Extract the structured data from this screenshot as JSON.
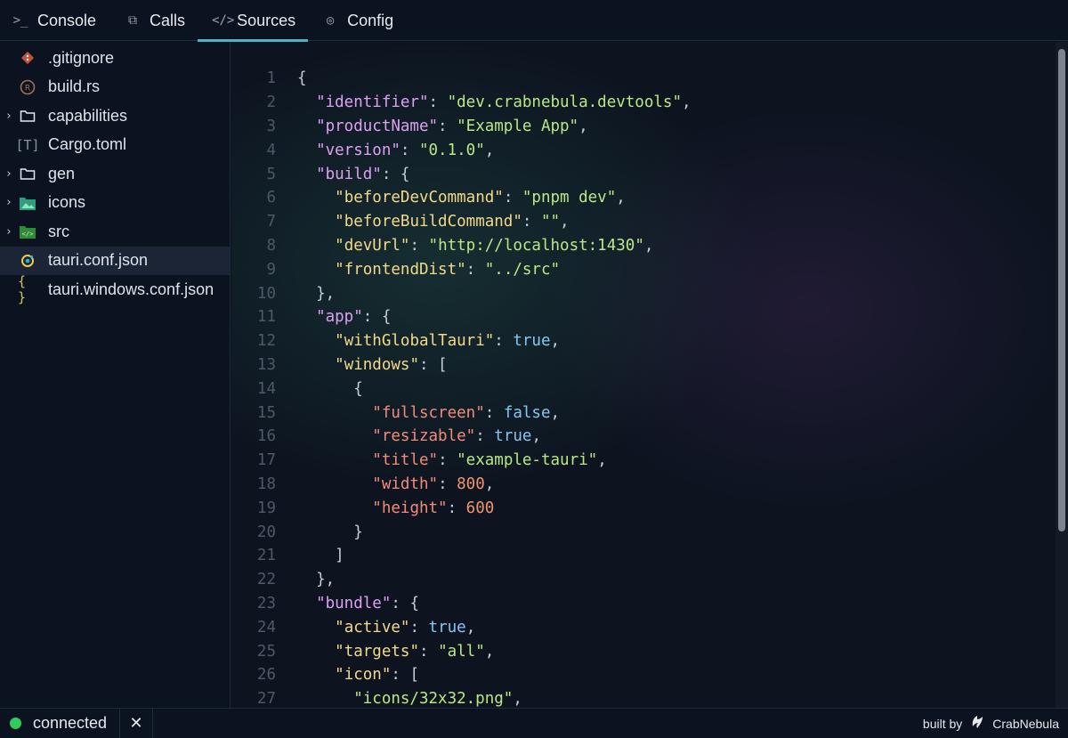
{
  "tabs": [
    {
      "label": "Console",
      "icon": "terminal-icon",
      "glyph": ">_"
    },
    {
      "label": "Calls",
      "icon": "calls-icon",
      "glyph": "⧉"
    },
    {
      "label": "Sources",
      "icon": "code-icon",
      "glyph": "</>"
    },
    {
      "label": "Config",
      "icon": "config-icon",
      "glyph": "◎"
    }
  ],
  "active_tab": "Sources",
  "files": [
    {
      "name": ".gitignore",
      "type": "file",
      "icon": "git-icon"
    },
    {
      "name": "build.rs",
      "type": "file",
      "icon": "rust-icon"
    },
    {
      "name": "capabilities",
      "type": "folder",
      "icon": "folder-icon"
    },
    {
      "name": "Cargo.toml",
      "type": "file",
      "icon": "toml-icon"
    },
    {
      "name": "gen",
      "type": "folder",
      "icon": "folder-icon"
    },
    {
      "name": "icons",
      "type": "folder",
      "icon": "image-folder-icon"
    },
    {
      "name": "src",
      "type": "folder",
      "icon": "src-folder-icon"
    },
    {
      "name": "tauri.conf.json",
      "type": "file",
      "icon": "tauri-icon",
      "selected": true
    },
    {
      "name": "tauri.windows.conf.json",
      "type": "file",
      "icon": "json-icon"
    }
  ],
  "code_lines": [
    [
      [
        "{",
        "punc"
      ]
    ],
    [
      [
        "  ",
        "punc"
      ],
      [
        "\"identifier\"",
        "key1"
      ],
      [
        ": ",
        "punc"
      ],
      [
        "\"dev.crabnebula.devtools\"",
        "str"
      ],
      [
        ",",
        "punc"
      ]
    ],
    [
      [
        "  ",
        "punc"
      ],
      [
        "\"productName\"",
        "key1"
      ],
      [
        ": ",
        "punc"
      ],
      [
        "\"Example App\"",
        "str"
      ],
      [
        ",",
        "punc"
      ]
    ],
    [
      [
        "  ",
        "punc"
      ],
      [
        "\"version\"",
        "key1"
      ],
      [
        ": ",
        "punc"
      ],
      [
        "\"0.1.0\"",
        "str"
      ],
      [
        ",",
        "punc"
      ]
    ],
    [
      [
        "  ",
        "punc"
      ],
      [
        "\"build\"",
        "key1"
      ],
      [
        ": {",
        "punc"
      ]
    ],
    [
      [
        "    ",
        "punc"
      ],
      [
        "\"beforeDevCommand\"",
        "key2"
      ],
      [
        ": ",
        "punc"
      ],
      [
        "\"pnpm dev\"",
        "str"
      ],
      [
        ",",
        "punc"
      ]
    ],
    [
      [
        "    ",
        "punc"
      ],
      [
        "\"beforeBuildCommand\"",
        "key2"
      ],
      [
        ": ",
        "punc"
      ],
      [
        "\"\"",
        "str"
      ],
      [
        ",",
        "punc"
      ]
    ],
    [
      [
        "    ",
        "punc"
      ],
      [
        "\"devUrl\"",
        "key2"
      ],
      [
        ": ",
        "punc"
      ],
      [
        "\"http://localhost:1430\"",
        "str"
      ],
      [
        ",",
        "punc"
      ]
    ],
    [
      [
        "    ",
        "punc"
      ],
      [
        "\"frontendDist\"",
        "key2"
      ],
      [
        ": ",
        "punc"
      ],
      [
        "\"../src\"",
        "str"
      ]
    ],
    [
      [
        "  },",
        "punc"
      ]
    ],
    [
      [
        "  ",
        "punc"
      ],
      [
        "\"app\"",
        "key1"
      ],
      [
        ": {",
        "punc"
      ]
    ],
    [
      [
        "    ",
        "punc"
      ],
      [
        "\"withGlobalTauri\"",
        "key2"
      ],
      [
        ": ",
        "punc"
      ],
      [
        "true",
        "bool"
      ],
      [
        ",",
        "punc"
      ]
    ],
    [
      [
        "    ",
        "punc"
      ],
      [
        "\"windows\"",
        "key2"
      ],
      [
        ": [",
        "punc"
      ]
    ],
    [
      [
        "      {",
        "punc"
      ]
    ],
    [
      [
        "        ",
        "punc"
      ],
      [
        "\"fullscreen\"",
        "key3"
      ],
      [
        ": ",
        "punc"
      ],
      [
        "false",
        "bool"
      ],
      [
        ",",
        "punc"
      ]
    ],
    [
      [
        "        ",
        "punc"
      ],
      [
        "\"resizable\"",
        "key3"
      ],
      [
        ": ",
        "punc"
      ],
      [
        "true",
        "bool"
      ],
      [
        ",",
        "punc"
      ]
    ],
    [
      [
        "        ",
        "punc"
      ],
      [
        "\"title\"",
        "key3"
      ],
      [
        ": ",
        "punc"
      ],
      [
        "\"example-tauri\"",
        "str"
      ],
      [
        ",",
        "punc"
      ]
    ],
    [
      [
        "        ",
        "punc"
      ],
      [
        "\"width\"",
        "key3"
      ],
      [
        ": ",
        "punc"
      ],
      [
        "800",
        "num"
      ],
      [
        ",",
        "punc"
      ]
    ],
    [
      [
        "        ",
        "punc"
      ],
      [
        "\"height\"",
        "key3"
      ],
      [
        ": ",
        "punc"
      ],
      [
        "600",
        "num"
      ]
    ],
    [
      [
        "      }",
        "punc"
      ]
    ],
    [
      [
        "    ]",
        "punc"
      ]
    ],
    [
      [
        "  },",
        "punc"
      ]
    ],
    [
      [
        "  ",
        "punc"
      ],
      [
        "\"bundle\"",
        "key1"
      ],
      [
        ": {",
        "punc"
      ]
    ],
    [
      [
        "    ",
        "punc"
      ],
      [
        "\"active\"",
        "key2"
      ],
      [
        ": ",
        "punc"
      ],
      [
        "true",
        "bool"
      ],
      [
        ",",
        "punc"
      ]
    ],
    [
      [
        "    ",
        "punc"
      ],
      [
        "\"targets\"",
        "key2"
      ],
      [
        ": ",
        "punc"
      ],
      [
        "\"all\"",
        "str"
      ],
      [
        ",",
        "punc"
      ]
    ],
    [
      [
        "    ",
        "punc"
      ],
      [
        "\"icon\"",
        "key2"
      ],
      [
        ": [",
        "punc"
      ]
    ],
    [
      [
        "      ",
        "punc"
      ],
      [
        "\"icons/32x32.png\"",
        "str"
      ],
      [
        ",",
        "punc"
      ]
    ]
  ],
  "status": {
    "text": "connected",
    "color": "#2ecc5a",
    "close_label": "✕"
  },
  "footer": {
    "built_by": "built by",
    "brand": "CrabNebula"
  },
  "colors": {
    "accent": "#4fb3c8",
    "background": "#0b1220"
  }
}
